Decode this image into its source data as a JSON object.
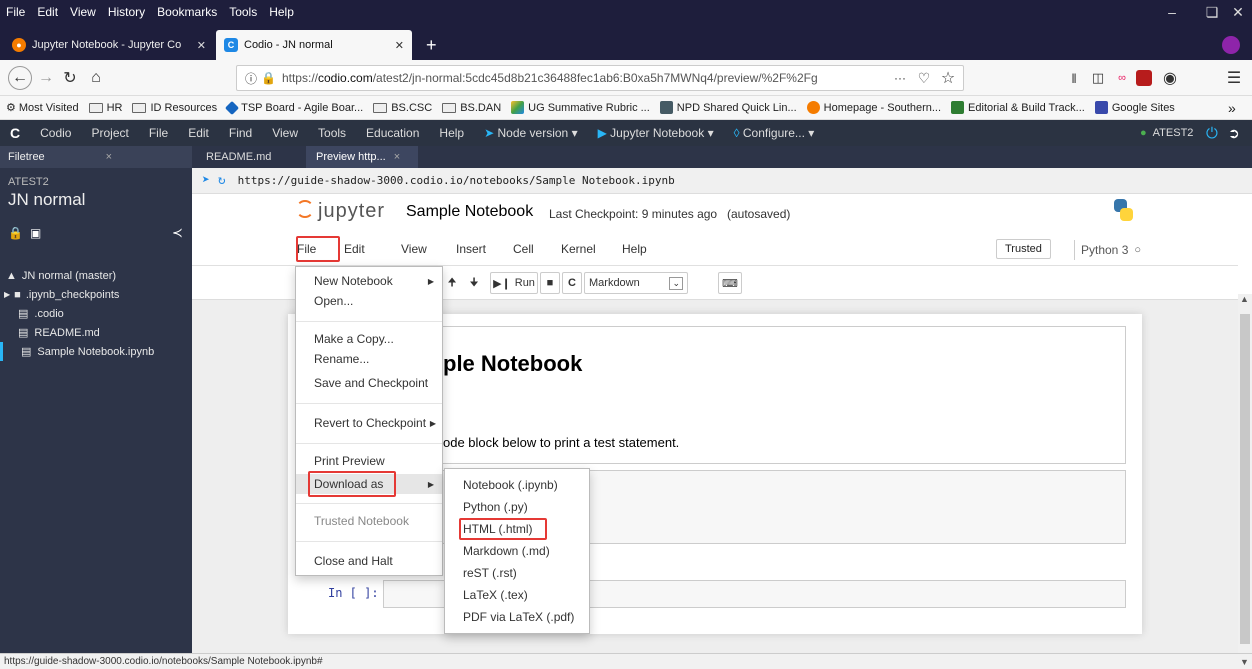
{
  "browser": {
    "menu": [
      "File",
      "Edit",
      "View",
      "History",
      "Bookmarks",
      "Tools",
      "Help"
    ],
    "tabs": [
      {
        "label": "Jupyter Notebook - Jupyter Co",
        "active": false
      },
      {
        "label": "Codio - JN normal",
        "active": true
      }
    ],
    "url_prefix": "https://",
    "url_host": "codio.com",
    "url_rest": "/atest2/jn-normal:5cdc45d8b21c36488fec1ab6:B0xa5h7MWNq4/preview/%2F%2Fg",
    "url_more": "···",
    "bookmarks": [
      "Most Visited",
      "HR",
      "ID Resources",
      "TSP Board - Agile Boar...",
      "BS.CSC",
      "BS.DAN",
      "UG Summative Rubric ...",
      "NPD Shared Quick Lin...",
      "Homepage - Southern...",
      "Editorial & Build Track...",
      "Google Sites"
    ],
    "bookmarks_more": "»",
    "status_url": "https://guide-shadow-3000.codio.io/notebooks/Sample Notebook.ipynb#"
  },
  "codio": {
    "logo": "C",
    "menu": [
      "Codio",
      "Project",
      "File",
      "Edit",
      "Find",
      "View",
      "Tools",
      "Education",
      "Help"
    ],
    "node_version": "Node version",
    "jupyter_btn": "Jupyter Notebook",
    "configure": "Configure...",
    "user": "ATEST2"
  },
  "sidebar": {
    "tab": "Filetree",
    "tab_close": "×",
    "user": "ATEST2",
    "project": "JN normal",
    "tree": [
      {
        "label": "JN normal (master)",
        "icon": "folder-open-icon",
        "indent": 0
      },
      {
        "label": ".ipynb_checkpoints",
        "icon": "folder-icon",
        "indent": 1
      },
      {
        "label": ".codio",
        "icon": "file-icon",
        "indent": 2
      },
      {
        "label": "README.md",
        "icon": "file-icon",
        "indent": 2
      },
      {
        "label": "Sample Notebook.ipynb",
        "icon": "file-icon",
        "indent": 2
      }
    ]
  },
  "editor": {
    "tabs": [
      "README.md",
      "Preview http..."
    ],
    "tab_close": "×",
    "preview_url": "https://guide-shadow-3000.codio.io/notebooks/Sample Notebook.ipynb"
  },
  "jupyter": {
    "brand": "jupyter",
    "notebook_name": "Sample Notebook",
    "checkpoint": "Last Checkpoint: 9 minutes ago",
    "autosaved": "(autosaved)",
    "menu": [
      "File",
      "Edit",
      "View",
      "Insert",
      "Cell",
      "Kernel",
      "Help"
    ],
    "trusted": "Trusted",
    "kernel": "Python 3",
    "run_label": "Run",
    "cell_type": "Markdown",
    "heading_fragment": "ple Notebook",
    "text_fragment": "ode block below to print a test statement.",
    "prompt": "In [ ]:"
  },
  "file_menu": {
    "items": [
      {
        "label": "New Notebook",
        "submenu": true,
        "disabled": false
      },
      {
        "label": "Open...",
        "submenu": false,
        "disabled": false
      },
      {
        "sep": true
      },
      {
        "label": "Make a Copy...",
        "submenu": false,
        "disabled": false
      },
      {
        "label": "Rename...",
        "submenu": false,
        "disabled": false
      },
      {
        "label": "Save and Checkpoint",
        "submenu": false,
        "disabled": false
      },
      {
        "sep": true
      },
      {
        "label": "Revert to Checkpoint",
        "submenu": true,
        "disabled": false
      },
      {
        "sep": true
      },
      {
        "label": "Print Preview",
        "submenu": false,
        "disabled": false
      },
      {
        "label": "Download as",
        "submenu": true,
        "disabled": false
      },
      {
        "sep": true
      },
      {
        "label": "Trusted Notebook",
        "submenu": false,
        "disabled": true
      },
      {
        "sep": true
      },
      {
        "label": "Close and Halt",
        "submenu": false,
        "disabled": false
      }
    ]
  },
  "download_menu": {
    "items": [
      "Notebook (.ipynb)",
      "Python (.py)",
      "HTML (.html)",
      "Markdown (.md)",
      "reST (.rst)",
      "LaTeX (.tex)",
      "PDF via LaTeX (.pdf)"
    ]
  }
}
